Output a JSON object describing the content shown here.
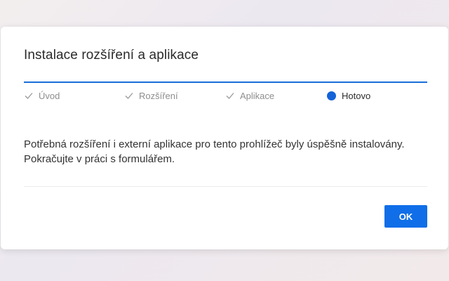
{
  "dialog": {
    "title": "Instalace rozšíření a aplikace",
    "accent_color": "#1a6fd8",
    "steps": [
      {
        "label": "Úvod",
        "state": "done",
        "icon": "check-icon"
      },
      {
        "label": "Rozšíření",
        "state": "done",
        "icon": "check-icon"
      },
      {
        "label": "Aplikace",
        "state": "done",
        "icon": "check-icon"
      },
      {
        "label": "Hotovo",
        "state": "active",
        "icon": "active-step-dot"
      }
    ],
    "message": "Potřebná rozšíření i externí aplikace pro tento prohlížeč byly úspěšně instalovány. Pokračujte v práci s formulářem.",
    "ok_label": "OK",
    "ok_color": "#0f6ee8"
  }
}
